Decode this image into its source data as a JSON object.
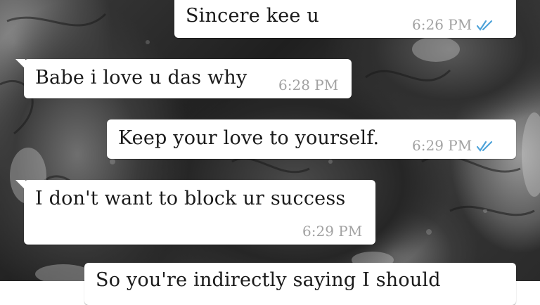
{
  "chat": {
    "tick_color": "#4fa3d9",
    "messages": [
      {
        "direction": "outgoing",
        "text": "Sincere kee u",
        "time": "6:26 PM",
        "status": "double-tick-read"
      },
      {
        "direction": "incoming",
        "text": "Babe i love u das why",
        "time": "6:28 PM"
      },
      {
        "direction": "outgoing",
        "text": "Keep your love to yourself.",
        "time": "6:29 PM",
        "status": "double-tick-read"
      },
      {
        "direction": "incoming",
        "text": "I don't want to block ur success",
        "time": "6:29 PM"
      },
      {
        "direction": "outgoing",
        "text": "So you're indirectly saying I should",
        "time": ""
      }
    ]
  }
}
